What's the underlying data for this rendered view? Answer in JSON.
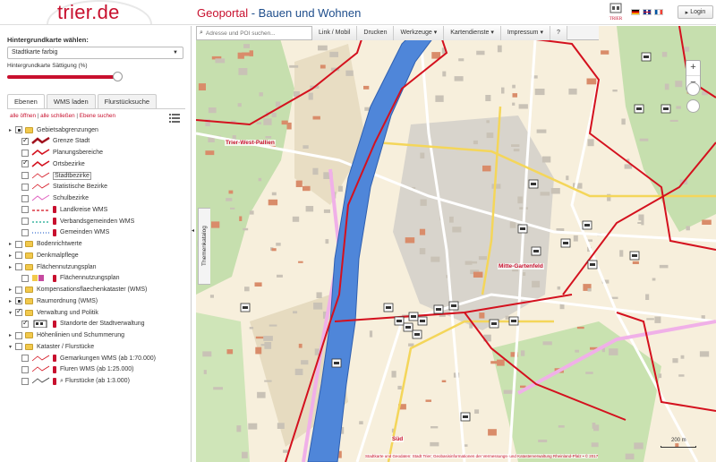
{
  "header": {
    "logo": "trier.de",
    "title_part1": "Geoportal",
    "title_sep": " - ",
    "title_part2": "Bauen und Wohnen",
    "emblem_text": "TRIER",
    "login_label": "Login",
    "flags": [
      "german-flag",
      "english-flag",
      "french-flag"
    ]
  },
  "sidebar": {
    "background_label": "Hintergrundkarte wählen:",
    "background_selected": "Stadtkarte farbig",
    "saturation_label": "Hintergrundkarte Sättigung (%)",
    "saturation_value": 0.93,
    "tabs": [
      "Ebenen",
      "WMS laden",
      "Flurstücksuche"
    ],
    "active_tab": "Ebenen",
    "links": [
      "alle öffnen",
      "alle schließen",
      "Ebene suchen"
    ],
    "link_sep": " | "
  },
  "tree": [
    {
      "label": "Gebietsabgrenzungen",
      "level": 0,
      "expander": "▸",
      "check": "partial",
      "folder": true
    },
    {
      "label": "Grenze Stadt",
      "level": 1,
      "check": "checked",
      "symbol": "thick-red-line"
    },
    {
      "label": "Planungsbereiche",
      "level": 1,
      "check": "unchecked",
      "symbol": "red-line"
    },
    {
      "label": "Ortsbezirke",
      "level": 1,
      "check": "checked",
      "symbol": "red-line"
    },
    {
      "label": "Stadtbezirke",
      "level": 1,
      "check": "unchecked",
      "symbol": "thin-red-line"
    },
    {
      "label": "Statistische Bezirke",
      "level": 1,
      "check": "unchecked",
      "symbol": "thin-red-line"
    },
    {
      "label": "Schulbezirke",
      "level": 1,
      "check": "unchecked",
      "symbol": "pink-line"
    },
    {
      "label": "Landkreise WMS",
      "level": 1,
      "check": "unchecked",
      "symbol": "dash-red",
      "pin": true
    },
    {
      "label": "Verbandsgemeinden WMS",
      "level": 1,
      "check": "unchecked",
      "symbol": "dash-teal",
      "pin": true
    },
    {
      "label": "Gemeinden WMS",
      "level": 1,
      "check": "unchecked",
      "symbol": "dash-blue",
      "pin": true
    },
    {
      "label": "Bodenrichtwerte",
      "level": 0,
      "expander": "▸",
      "check": "unchecked",
      "folder": true
    },
    {
      "label": "Denkmalpflege",
      "level": 0,
      "expander": "▸",
      "check": "unchecked",
      "folder": true
    },
    {
      "label": "Flächennutzungsplan",
      "level": 0,
      "expander": "▸",
      "check": "unchecked",
      "folder": true
    },
    {
      "label": "Flächennutzungsplan",
      "level": 1,
      "check": "unchecked",
      "symbol": "fnp",
      "pin": true
    },
    {
      "label": "Kompensationsflaechenkataster (WMS)",
      "level": 0,
      "expander": "▸",
      "check": "unchecked",
      "folder": true
    },
    {
      "label": "Raumordnung (WMS)",
      "level": 0,
      "expander": "▸",
      "check": "partial",
      "folder": true
    },
    {
      "label": "Verwaltung und Politik",
      "level": 0,
      "expander": "▾",
      "check": "checked",
      "folder": true
    },
    {
      "label": "Standorte der Stadtverwaltung",
      "level": 1,
      "check": "checked",
      "symbol": "building",
      "pin": true
    },
    {
      "label": "Höhenlinien und Schummerung",
      "level": 0,
      "expander": "▸",
      "check": "unchecked",
      "folder": true
    },
    {
      "label": "Kataster / Flurstücke",
      "level": 0,
      "expander": "▾",
      "check": "unchecked",
      "folder": true
    },
    {
      "label": "Gemarkungen WMS (ab 1:70.000)",
      "level": 1,
      "check": "unchecked",
      "symbol": "thin-red-line",
      "pin": true
    },
    {
      "label": "Fluren WMS (ab 1:25.000)",
      "level": 1,
      "check": "unchecked",
      "symbol": "thin-red-line",
      "pin": true
    },
    {
      "label": "Flurstücke (ab 1:3.000)",
      "level": 1,
      "check": "unchecked",
      "symbol": "dark-line",
      "pin": true,
      "magnifier": true
    }
  ],
  "toolbar": {
    "search_placeholder": "Adresse und POI suchen...",
    "buttons": [
      "Link / Mobil",
      "Drucken",
      "Werkzeuge ▾",
      "Kartendienste ▾",
      "Impressum ▾",
      "?"
    ]
  },
  "map": {
    "themen_label": "Themenkatalog",
    "districts": [
      "Trier-West-Pallien",
      "Mitte-Gartenfeld",
      "Süd"
    ],
    "scale_label": "200 m",
    "copyright": "Stadtkarte und Geodaten: Stadt Trier; Geobasisinformationen der Vermessungs- und Katasterverwaltung Rheinland-Pfalz • © 2017",
    "colors": {
      "river": "#4f86d9",
      "boundary": "#d4111e",
      "background": "#f7efdc",
      "green": "#bcd9a0"
    }
  }
}
